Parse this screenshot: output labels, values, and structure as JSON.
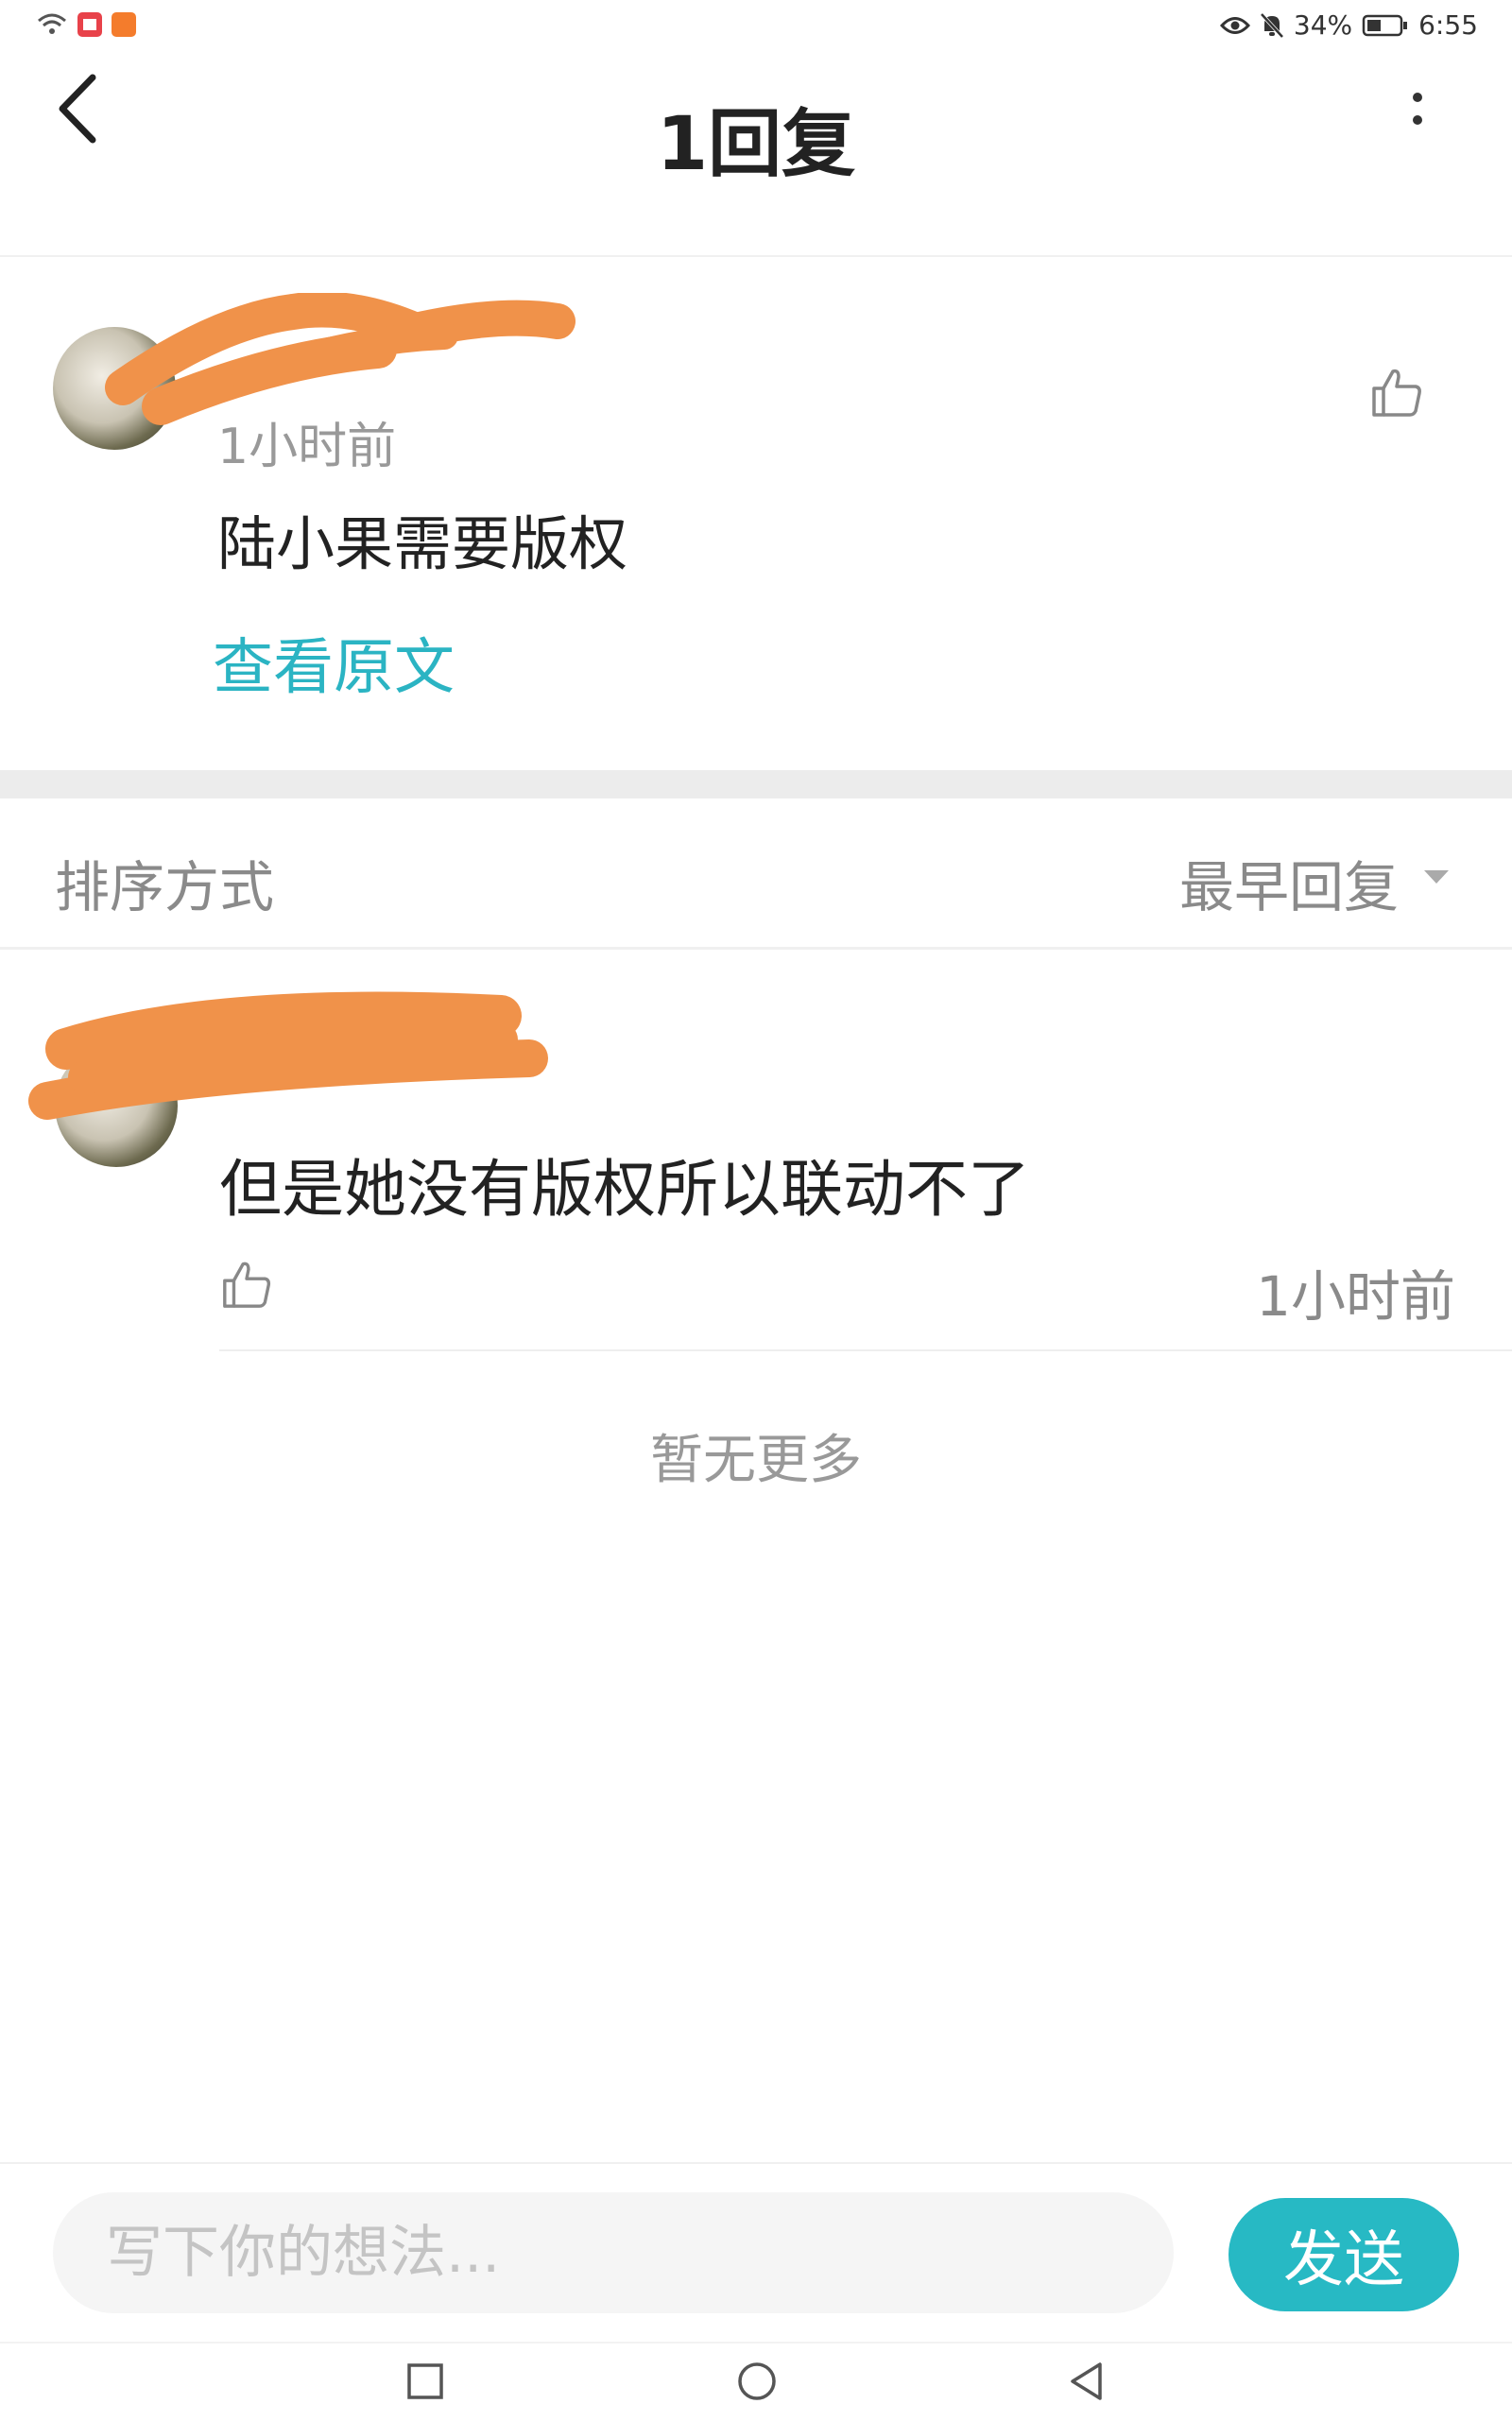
{
  "status_bar": {
    "battery": "34%",
    "time": "6:55",
    "icons": [
      "wifi-icon",
      "app-notification-icon",
      "taobao-icon",
      "eye-icon",
      "bell-off-icon",
      "battery-icon"
    ]
  },
  "header": {
    "title": "1回复",
    "back_icon": "chevron-left-icon",
    "more_icon": "more-vertical-icon"
  },
  "original_comment": {
    "time": "1小时前",
    "text": "陆小果需要版权",
    "view_original": "查看原文",
    "like_icon": "thumbs-up-icon"
  },
  "sort": {
    "label": "排序方式",
    "value": "最早回复",
    "caret_icon": "caret-down-icon"
  },
  "reply": {
    "text": "但是她没有版权所以联动不了",
    "time": "1小时前",
    "like_icon": "thumbs-up-icon"
  },
  "footer_note": "暂无更多",
  "input": {
    "placeholder": "写下你的想法...",
    "value": "",
    "send_label": "发送"
  },
  "colors": {
    "accent": "#27b9c4",
    "link": "#2bb4c3",
    "redaction": "#f0924a"
  },
  "nav_icons": [
    "recent-apps-icon",
    "home-icon",
    "back-triangle-icon"
  ]
}
